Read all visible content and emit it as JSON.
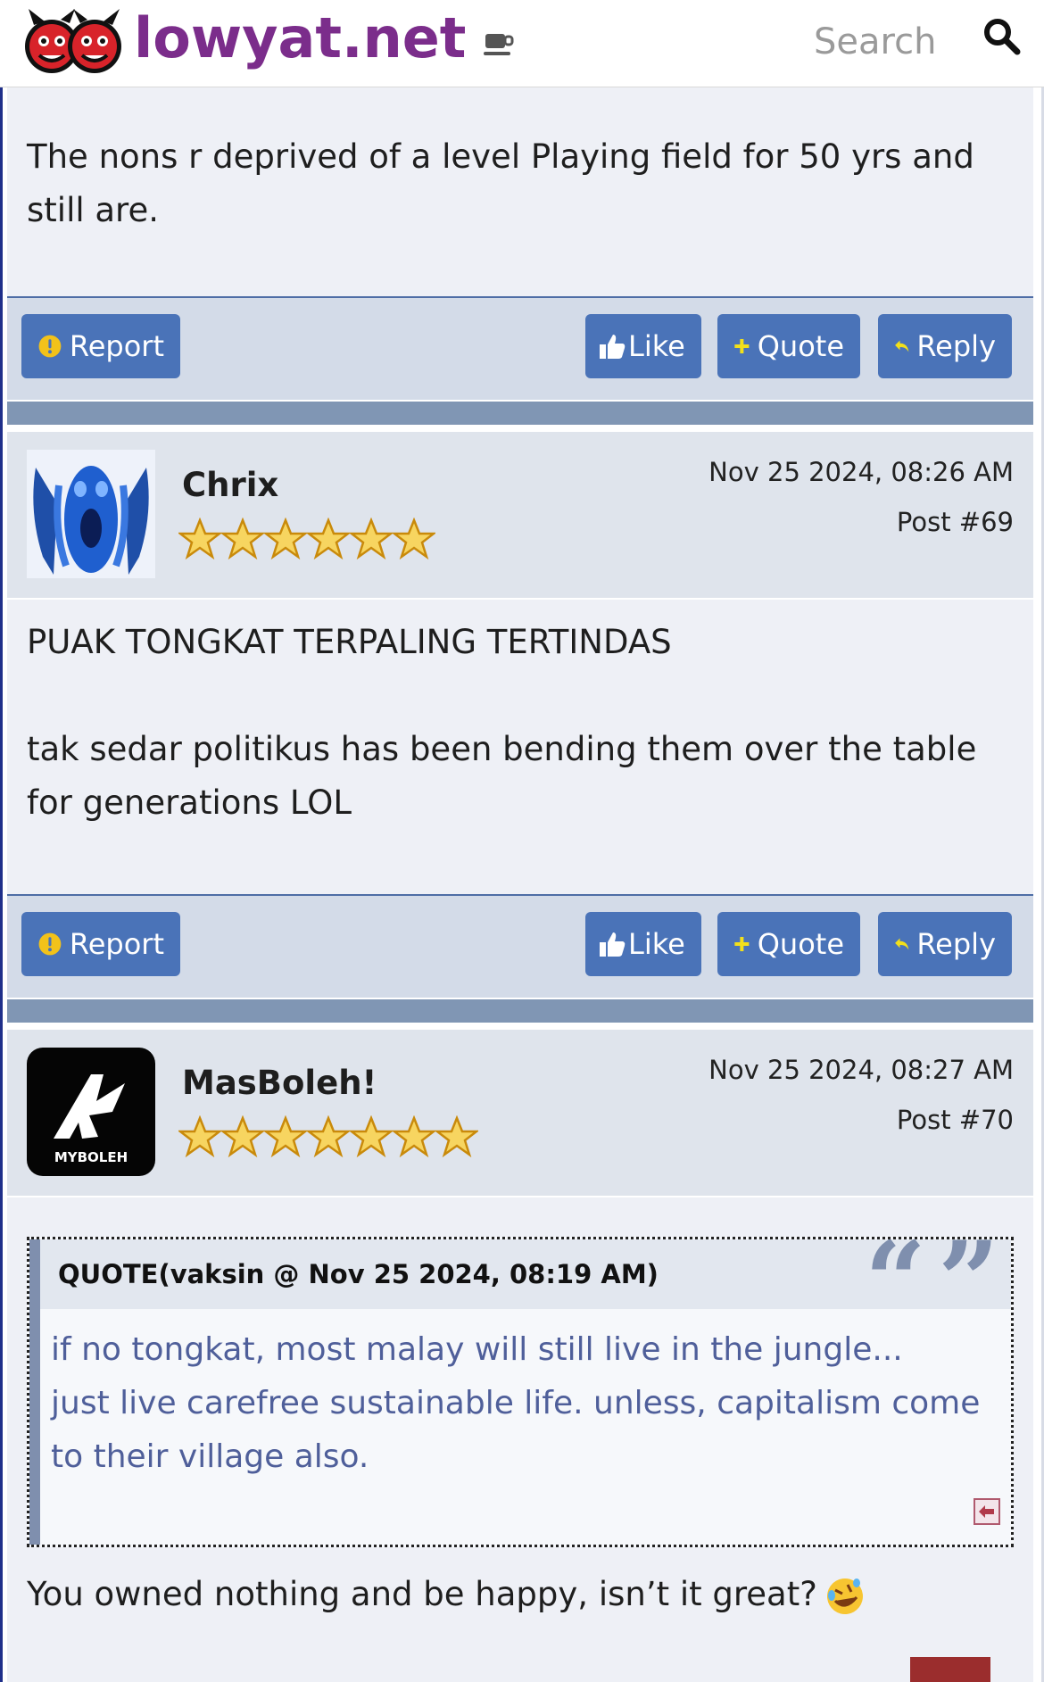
{
  "header": {
    "logo_text": "lowyat.net",
    "cup_icon": "coffee-cup-icon",
    "search_placeholder": "Search",
    "search_icon": "magnifier-icon"
  },
  "previous_post": {
    "text": "The nons r deprived of a level Playing field for 50 yrs and still are."
  },
  "buttons": {
    "report": "Report",
    "like": "Like",
    "quote": "Quote",
    "reply": "Reply",
    "report_icon": "exclamation-circle-icon",
    "like_icon": "thumbs-up-icon",
    "quote_icon": "plus-icon",
    "reply_icon": "reply-arrow-icon"
  },
  "posts": [
    {
      "username": "Chrix",
      "stars": 6,
      "date": "Nov 25 2024, 08:26 AM",
      "post_number": "Post #69",
      "body_line1": "PUAK TONGKAT TERPALING TERTINDAS",
      "body_line2": "tak sedar politikus has been bending them over the table for generations LOL"
    },
    {
      "username": "MasBoleh!",
      "stars": 7,
      "avatar_text": "MYBOLEH",
      "date": "Nov 25 2024, 08:27 AM",
      "post_number": "Post #70",
      "quote": {
        "label": "QUOTE(vaksin @ Nov 25 2024, 08:19 AM)",
        "line1": "if no tongkat, most malay will still live in the jungle...",
        "line2": "just live carefree sustainable life. unless, capitalism come to their village also."
      },
      "reply_text": "You owned nothing and be happy, isn’t it great?",
      "emoji": "rolling-on-floor-laughing-emoji"
    }
  ],
  "colors": {
    "brand": "#7b2d8b",
    "button": "#4a73b8",
    "divider": "#8096b4",
    "quote_text": "#4f5f9a"
  }
}
